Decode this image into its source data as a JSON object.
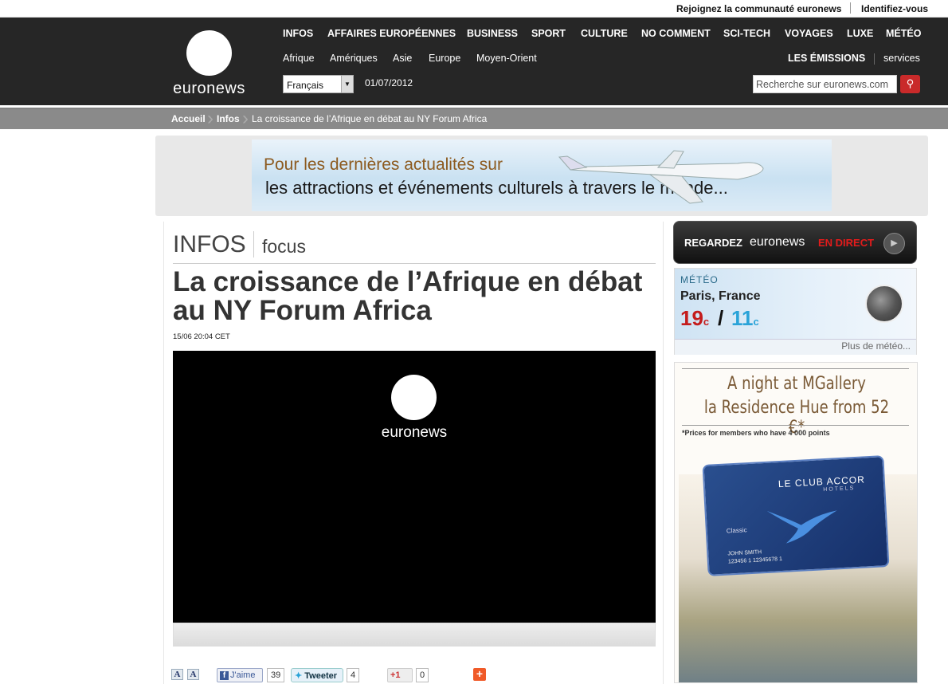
{
  "topbar": {
    "community": "Rejoignez la communauté euronews",
    "login": "Identifiez-vous"
  },
  "logo": {
    "text": "euronews"
  },
  "nav": [
    "INFOS",
    "AFFAIRES EUROPÉENNES",
    "BUSINESS",
    "SPORT",
    "CULTURE",
    "NO COMMENT",
    "SCI-TECH",
    "VOYAGES",
    "LUXE",
    "MÉTÉO"
  ],
  "subnav": [
    "Afrique",
    "Amériques",
    "Asie",
    "Europe",
    "Moyen-Orient"
  ],
  "emissions": "LES ÉMISSIONS",
  "services": "services",
  "language": "Français",
  "date": "01/07/2012",
  "search": {
    "placeholder": "Recherche sur euronews.com"
  },
  "breadcrumb": {
    "home": "Accueil",
    "section": "Infos",
    "current": "La croissance de l’Afrique en débat au NY Forum Africa"
  },
  "banner": {
    "line1": "Pour les dernières actualités sur",
    "line2": "les attractions et événements culturels à travers le monde..."
  },
  "article": {
    "section": "INFOS",
    "subsection": "focus",
    "title": "La croissance de l’Afrique en débat au NY Forum Africa",
    "timestamp": "15/06 20:04 CET",
    "video_logo": "euronews"
  },
  "social": {
    "font_small": "A",
    "font_large": "A",
    "like_label": "J'aime",
    "like_count": "39",
    "tweet_label": "Tweeter",
    "tweet_count": "4",
    "gplus_label": "+1",
    "gplus_count": "0",
    "share_plus": "+"
  },
  "live": {
    "prefix": "REGARDEZ",
    "brand": "euronews",
    "suffix": "EN DIRECT"
  },
  "weather": {
    "label": "MÉTÉO",
    "city": "Paris, France",
    "high": "19",
    "low": "11",
    "unit": "c",
    "more": "Plus de météo..."
  },
  "hotel_ad": {
    "line1": "A night at MGallery",
    "line2": "la Residence Hue from 52 €*",
    "note": "*Prices for members who have 4 000 points",
    "card_brand": "LE CLUB ACCOR",
    "card_sub": "HOTELS",
    "card_class": "Classic",
    "card_name": "JOHN SMITH",
    "card_number": "123456 1 12345678 1"
  },
  "colors": {
    "header_bg": "#262626",
    "accent_red": "#c92a2a",
    "live_red": "#e41b1b",
    "cold_blue": "#2aa3d8"
  }
}
